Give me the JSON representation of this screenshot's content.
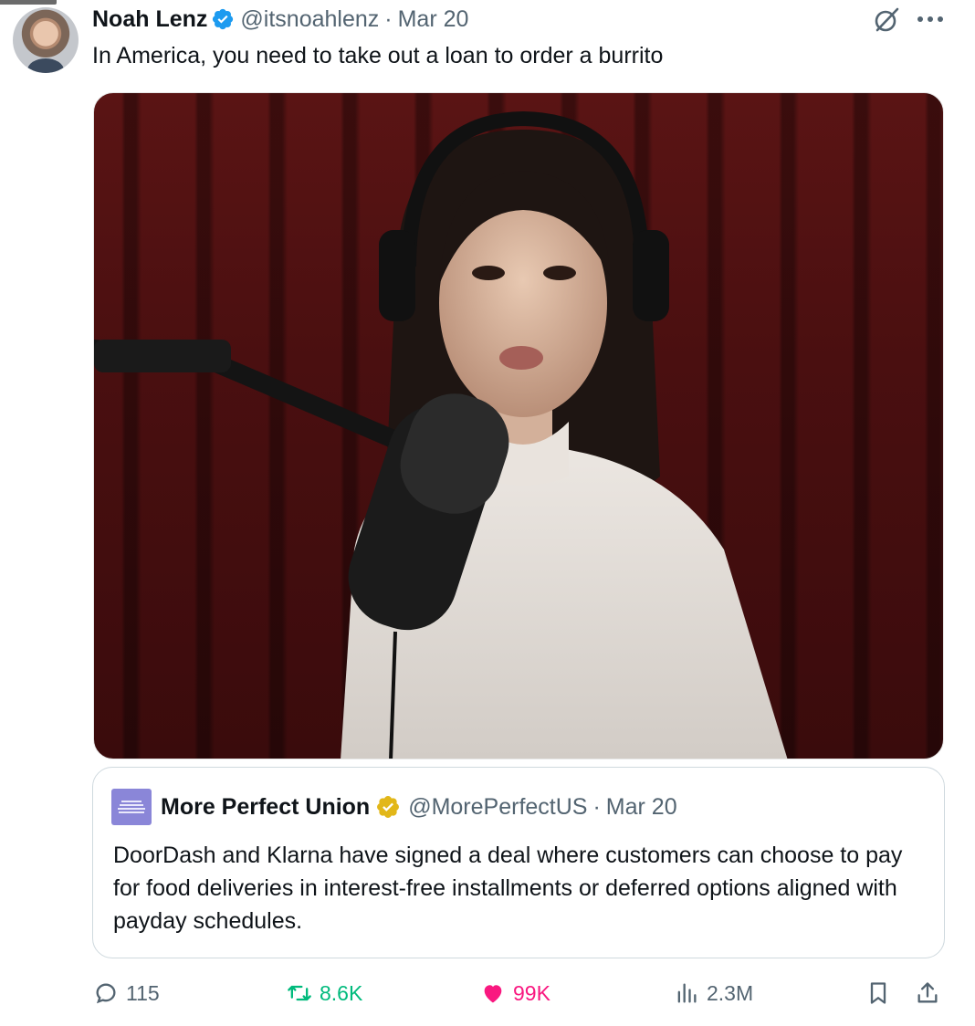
{
  "post": {
    "author": {
      "name": "Noah Lenz",
      "handle": "@itsnoahlenz",
      "separator": "·",
      "date": "Mar 20",
      "verified": true
    },
    "text": "In America, you need to take out a loan to order a burrito",
    "media": {
      "type": "photo",
      "alt": ""
    },
    "quoted_post": {
      "author": {
        "name": "More Perfect Union",
        "handle": "@MorePerfectUS",
        "separator": "·",
        "date": "Mar 20",
        "verified_org": true,
        "avatar_text": "MORE PERFECT UNION"
      },
      "text": "DoorDash and Klarna have signed a deal where customers can choose to pay for food deliveries in  interest-free installments or deferred options aligned with payday schedules."
    },
    "stats": {
      "replies": "115",
      "reposts": "8.6K",
      "likes": "99K",
      "views": "2.3M"
    },
    "icons": {
      "verified": "verified-badge-icon",
      "grok": "grok-icon",
      "more": "more-icon",
      "reply": "reply-icon",
      "repost": "repost-icon",
      "like": "heart-icon",
      "views": "views-icon",
      "bookmark": "bookmark-icon",
      "share": "share-icon"
    },
    "colors": {
      "verified_blue": "#1d9bf0",
      "gold_badge": "#e2b719",
      "repost_green": "#00ba7c",
      "like_pink": "#f91880",
      "secondary_text": "#536471"
    }
  }
}
